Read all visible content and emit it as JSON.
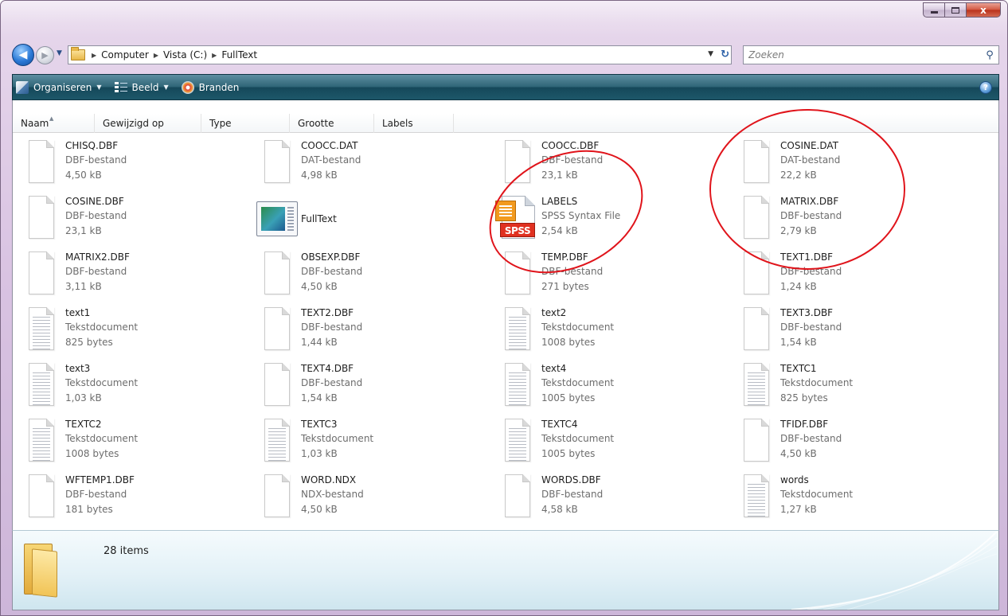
{
  "window": {
    "caption_buttons": {
      "minimize": "",
      "maximize": "",
      "close": "x"
    }
  },
  "nav": {
    "back_glyph": "◀",
    "forward_glyph": "▶",
    "breadcrumb": [
      "Computer",
      "Vista (C:)",
      "FullText"
    ],
    "separator_glyph": "▶",
    "search_placeholder": "Zoeken"
  },
  "toolbar": {
    "organize_label": "Organiseren",
    "view_label": "Beeld",
    "burn_label": "Branden",
    "dropdown_glyph": "▼",
    "help_glyph": "?"
  },
  "columns": [
    "Naam",
    "Gewijzigd op",
    "Type",
    "Grootte",
    "Labels"
  ],
  "files": [
    {
      "name": "CHISQ.DBF",
      "type": "DBF-bestand",
      "size": "4,50 kB",
      "icon": "blank-document-icon"
    },
    {
      "name": "COOCC.DAT",
      "type": "DAT-bestand",
      "size": "4,98 kB",
      "icon": "blank-document-icon"
    },
    {
      "name": "COOCC.DBF",
      "type": "DBF-bestand",
      "size": "23,1 kB",
      "icon": "blank-document-icon"
    },
    {
      "name": "COSINE.DAT",
      "type": "DAT-bestand",
      "size": "22,2 kB",
      "icon": "blank-document-icon"
    },
    {
      "name": "COSINE.DBF",
      "type": "DBF-bestand",
      "size": "23,1 kB",
      "icon": "blank-document-icon"
    },
    {
      "name": "FullText",
      "type": "",
      "size": "",
      "icon": "application-icon"
    },
    {
      "name": "LABELS",
      "type": "SPSS Syntax File",
      "size": "2,54 kB",
      "icon": "spss-syntax-icon"
    },
    {
      "name": "MATRIX.DBF",
      "type": "DBF-bestand",
      "size": "2,79 kB",
      "icon": "blank-document-icon"
    },
    {
      "name": "MATRIX2.DBF",
      "type": "DBF-bestand",
      "size": "3,11 kB",
      "icon": "blank-document-icon"
    },
    {
      "name": "OBSEXP.DBF",
      "type": "DBF-bestand",
      "size": "4,50 kB",
      "icon": "blank-document-icon"
    },
    {
      "name": "TEMP.DBF",
      "type": "DBF-bestand",
      "size": "271 bytes",
      "icon": "blank-document-icon"
    },
    {
      "name": "TEXT1.DBF",
      "type": "DBF-bestand",
      "size": "1,24 kB",
      "icon": "blank-document-icon"
    },
    {
      "name": "text1",
      "type": "Tekstdocument",
      "size": "825 bytes",
      "icon": "text-document-icon"
    },
    {
      "name": "TEXT2.DBF",
      "type": "DBF-bestand",
      "size": "1,44 kB",
      "icon": "blank-document-icon"
    },
    {
      "name": "text2",
      "type": "Tekstdocument",
      "size": "1008 bytes",
      "icon": "text-document-icon"
    },
    {
      "name": "TEXT3.DBF",
      "type": "DBF-bestand",
      "size": "1,54 kB",
      "icon": "blank-document-icon"
    },
    {
      "name": "text3",
      "type": "Tekstdocument",
      "size": "1,03 kB",
      "icon": "text-document-icon"
    },
    {
      "name": "TEXT4.DBF",
      "type": "DBF-bestand",
      "size": "1,54 kB",
      "icon": "blank-document-icon"
    },
    {
      "name": "text4",
      "type": "Tekstdocument",
      "size": "1005 bytes",
      "icon": "text-document-icon"
    },
    {
      "name": "TEXTC1",
      "type": "Tekstdocument",
      "size": "825 bytes",
      "icon": "text-document-icon"
    },
    {
      "name": "TEXTC2",
      "type": "Tekstdocument",
      "size": "1008 bytes",
      "icon": "text-document-icon"
    },
    {
      "name": "TEXTC3",
      "type": "Tekstdocument",
      "size": "1,03 kB",
      "icon": "text-document-icon"
    },
    {
      "name": "TEXTC4",
      "type": "Tekstdocument",
      "size": "1005 bytes",
      "icon": "text-document-icon"
    },
    {
      "name": "TFIDF.DBF",
      "type": "DBF-bestand",
      "size": "4,50 kB",
      "icon": "blank-document-icon"
    },
    {
      "name": "WFTEMP1.DBF",
      "type": "DBF-bestand",
      "size": "181 bytes",
      "icon": "blank-document-icon"
    },
    {
      "name": "WORD.NDX",
      "type": "NDX-bestand",
      "size": "4,50 kB",
      "icon": "blank-document-icon"
    },
    {
      "name": "WORDS.DBF",
      "type": "DBF-bestand",
      "size": "4,58 kB",
      "icon": "blank-document-icon"
    },
    {
      "name": "words",
      "type": "Tekstdocument",
      "size": "1,27 kB",
      "icon": "text-document-icon"
    }
  ],
  "details": {
    "item_count": "28 items"
  },
  "colors": {
    "command_bar": "#2f6577",
    "annotation_circle": "#e0141b",
    "secondary_text": "#6d6d6d"
  }
}
